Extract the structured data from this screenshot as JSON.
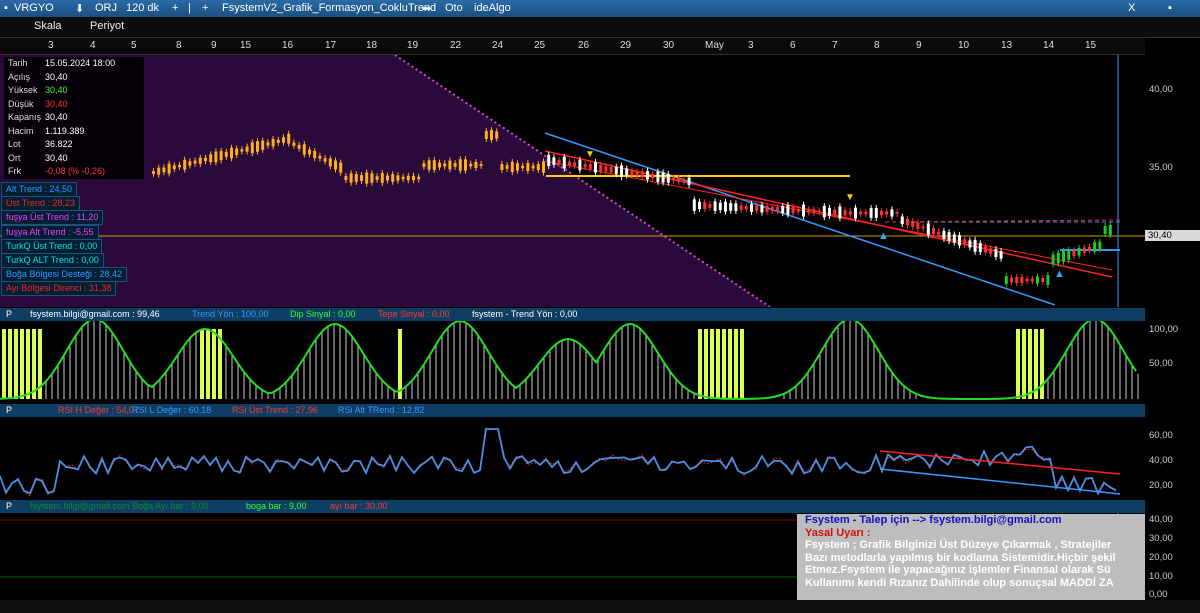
{
  "titlebar": {
    "symbol": "VRGYO",
    "mode": "ORJ",
    "period": "120 dk",
    "plus": "+",
    "bar": "|",
    "formula": "FsystemV2_Grafik_Formasyon_CokluTrend",
    "auto": "Oto",
    "brand": "ideAlgo",
    "close": "X"
  },
  "menu": {
    "scale": "Skala",
    "period": "Periyot"
  },
  "dates": [
    "3",
    "4",
    "5",
    "8",
    "9",
    "15",
    "16",
    "17",
    "18",
    "19",
    "22",
    "24",
    "25",
    "26",
    "29",
    "30",
    "May",
    "3",
    "6",
    "7",
    "8",
    "9",
    "10",
    "13",
    "14",
    "15"
  ],
  "info": {
    "rows": [
      {
        "k": "Tarih",
        "v": "15.05.2024 18:00",
        "c": "#ffffff"
      },
      {
        "k": "Açılış",
        "v": "30,40",
        "c": "#ffffff"
      },
      {
        "k": "Yüksek",
        "v": "30,40",
        "c": "#33ff33"
      },
      {
        "k": "Düşük",
        "v": "30,40",
        "c": "#ff3333"
      },
      {
        "k": "Kapanış",
        "v": "30,40",
        "c": "#ffffff"
      },
      {
        "k": "Hacim",
        "v": "1.119.389",
        "c": "#ffffff"
      },
      {
        "k": "Lot",
        "v": "36.822",
        "c": "#ffffff"
      },
      {
        "k": "Ort",
        "v": "30,40",
        "c": "#ffffff"
      },
      {
        "k": "Frk",
        "v": "-0,08 (% -0,26)",
        "c": "#ff3333"
      }
    ]
  },
  "trends": [
    {
      "text": "Alt Trend :  24,50",
      "color": "#3399ff"
    },
    {
      "text": "Üst Trend :  28,23",
      "color": "#ff2222"
    },
    {
      "text": "fuşya Üst Trend :  11,20",
      "color": "#ff33ff"
    },
    {
      "text": "fuşya Alt Trend :  -5,55",
      "color": "#ff33ff"
    },
    {
      "text": "TurkQ Üst Trend :  0,00",
      "color": "#00e5e5"
    },
    {
      "text": "TurkQ ALT Trend :  0,00",
      "color": "#00e5e5"
    },
    {
      "text": "Boğa Bölgesi Desteği :  28,42",
      "color": "#3399ff"
    },
    {
      "text": "Ayı Bölgesi Direnci :  31,38",
      "color": "#ff2222"
    }
  ],
  "price_axis": [
    "40,00",
    "35,00",
    "30,40"
  ],
  "current_price": "30,40",
  "pane2": {
    "p": "P",
    "email": "fsystem.bilgi@gmail.com :  99,46",
    "trend": "Trend Yön :  100,00",
    "dip": "Dip Sinyal :  0,00",
    "tepe": "Tepe Sinyal :  0,00",
    "fs": "fsystem - Trend Yön :  0,00",
    "axis": [
      "100,00",
      "50,00"
    ]
  },
  "pane3": {
    "p": "P",
    "rsih": "RSI H Değer :  54,07",
    "rsil": "RSI L Değer :  60,18",
    "rsiust": "RSi Üst Trend :  27,96",
    "rsialt": "RSi Alt TRend :  12,82",
    "axis": [
      "60,00",
      "40,00",
      "20,00"
    ]
  },
  "pane4": {
    "p": "P",
    "first": "fsystem.bilgi@gmail.com Boğa Ayı bar :  9,00",
    "boga": "boga bar :  9,00",
    "ayi": "ayı bar :  30,00",
    "axis": [
      "40,00",
      "30,00",
      "20,00",
      "10,00",
      "0,00"
    ]
  },
  "note": {
    "line1": "Fsystem - Talep için --> fsystem.bilgi@gmail.com",
    "line2": "Yasal Uyarı :",
    "line3": "Fsystem ; Grafik Bilginizi Üst Düzeye Çıkarmak , Stratejiler",
    "line4": "Bazı metodlarla yapılmış bir kodlama Sistemidir.Hiçbir şekil",
    "line5": "Etmez.Fsystem ile yapacağınız işlemler Finansal olarak Sü",
    "line6": "Kullanımı kendi Rızanız Dahilinde olup sonuçsal MADDİ ZA"
  },
  "colors": {
    "bg": "#000000",
    "purple": "#2a0a3a",
    "hdr": "#0e3e63",
    "up": "#ffb020",
    "upGreen": "#22cc22",
    "down": "#ff3030",
    "blue": "#3399ff",
    "yellow": "#ffcc00"
  }
}
